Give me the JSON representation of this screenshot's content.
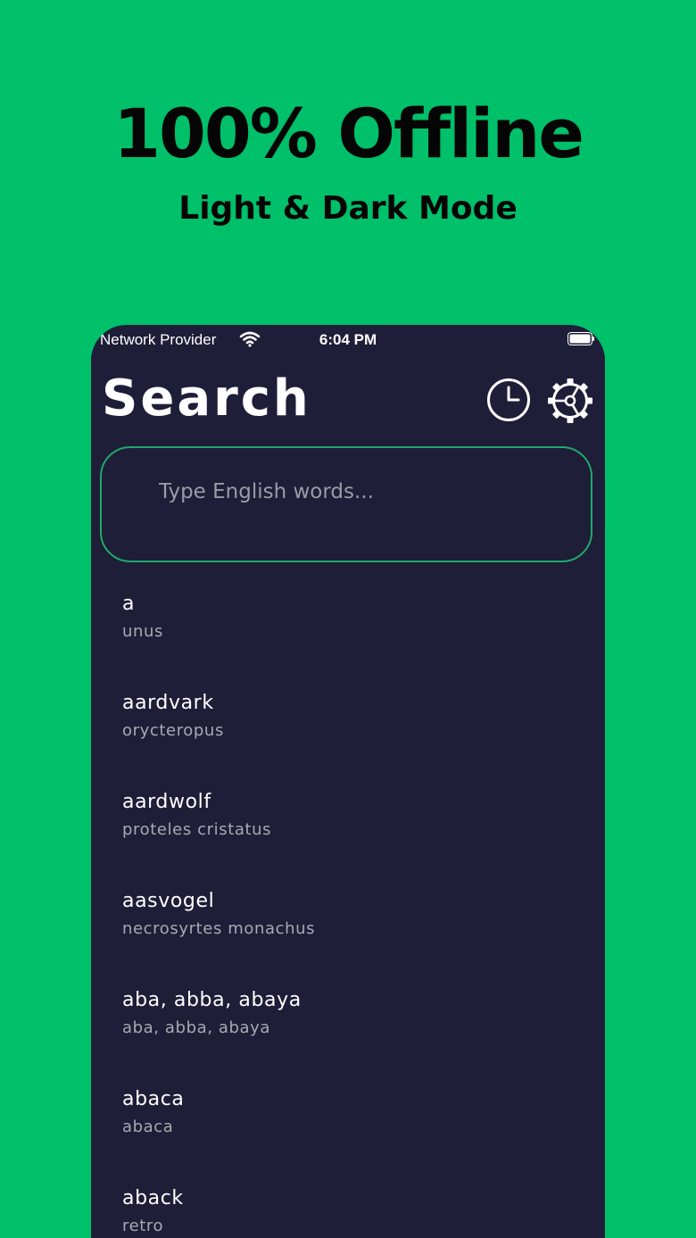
{
  "promo": {
    "headline": "100% Offline",
    "subheadline": "Light & Dark Mode"
  },
  "status_bar": {
    "provider": "Network Provider",
    "time": "6:04 PM",
    "icons": [
      "wifi-icon",
      "battery-icon"
    ]
  },
  "header": {
    "title": "Search",
    "history_icon": "clock-icon",
    "settings_icon": "gear-icon"
  },
  "search": {
    "placeholder": "Type English words...",
    "value": ""
  },
  "words": [
    {
      "term": "a",
      "translation": "unus"
    },
    {
      "term": "aardvark",
      "translation": "orycteropus"
    },
    {
      "term": "aardwolf",
      "translation": "proteles cristatus"
    },
    {
      "term": "aasvogel",
      "translation": "necrosyrtes monachus"
    },
    {
      "term": "aba, abba, abaya",
      "translation": "aba, abba, abaya"
    },
    {
      "term": "abaca",
      "translation": "abaca"
    },
    {
      "term": "aback",
      "translation": "retro"
    }
  ],
  "colors": {
    "background": "#00c06a",
    "phone_bg": "#1e1e38",
    "accent": "#1faa6a"
  }
}
